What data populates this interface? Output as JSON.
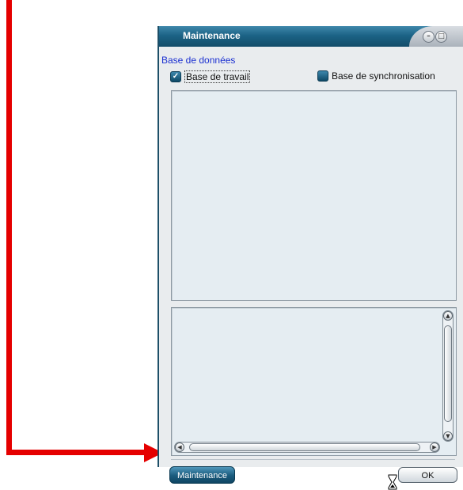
{
  "window": {
    "title": "Maintenance"
  },
  "database": {
    "section_label": "Base de données",
    "work_db": {
      "label": "Base de travail",
      "checked": true
    },
    "sync_db": {
      "label": "Base de synchronisation",
      "checked": false
    }
  },
  "footer": {
    "maintenance_label": "Maintenance",
    "ok_label": "OK"
  },
  "colors": {
    "annotation_arrow": "#e50000",
    "title_bar": "#1c6386",
    "section_label": "#1a2fd1"
  },
  "icons": {
    "minimize": "minimize-icon",
    "maximize": "maximize-icon",
    "busy_cursor": "hourglass-cursor-icon"
  }
}
